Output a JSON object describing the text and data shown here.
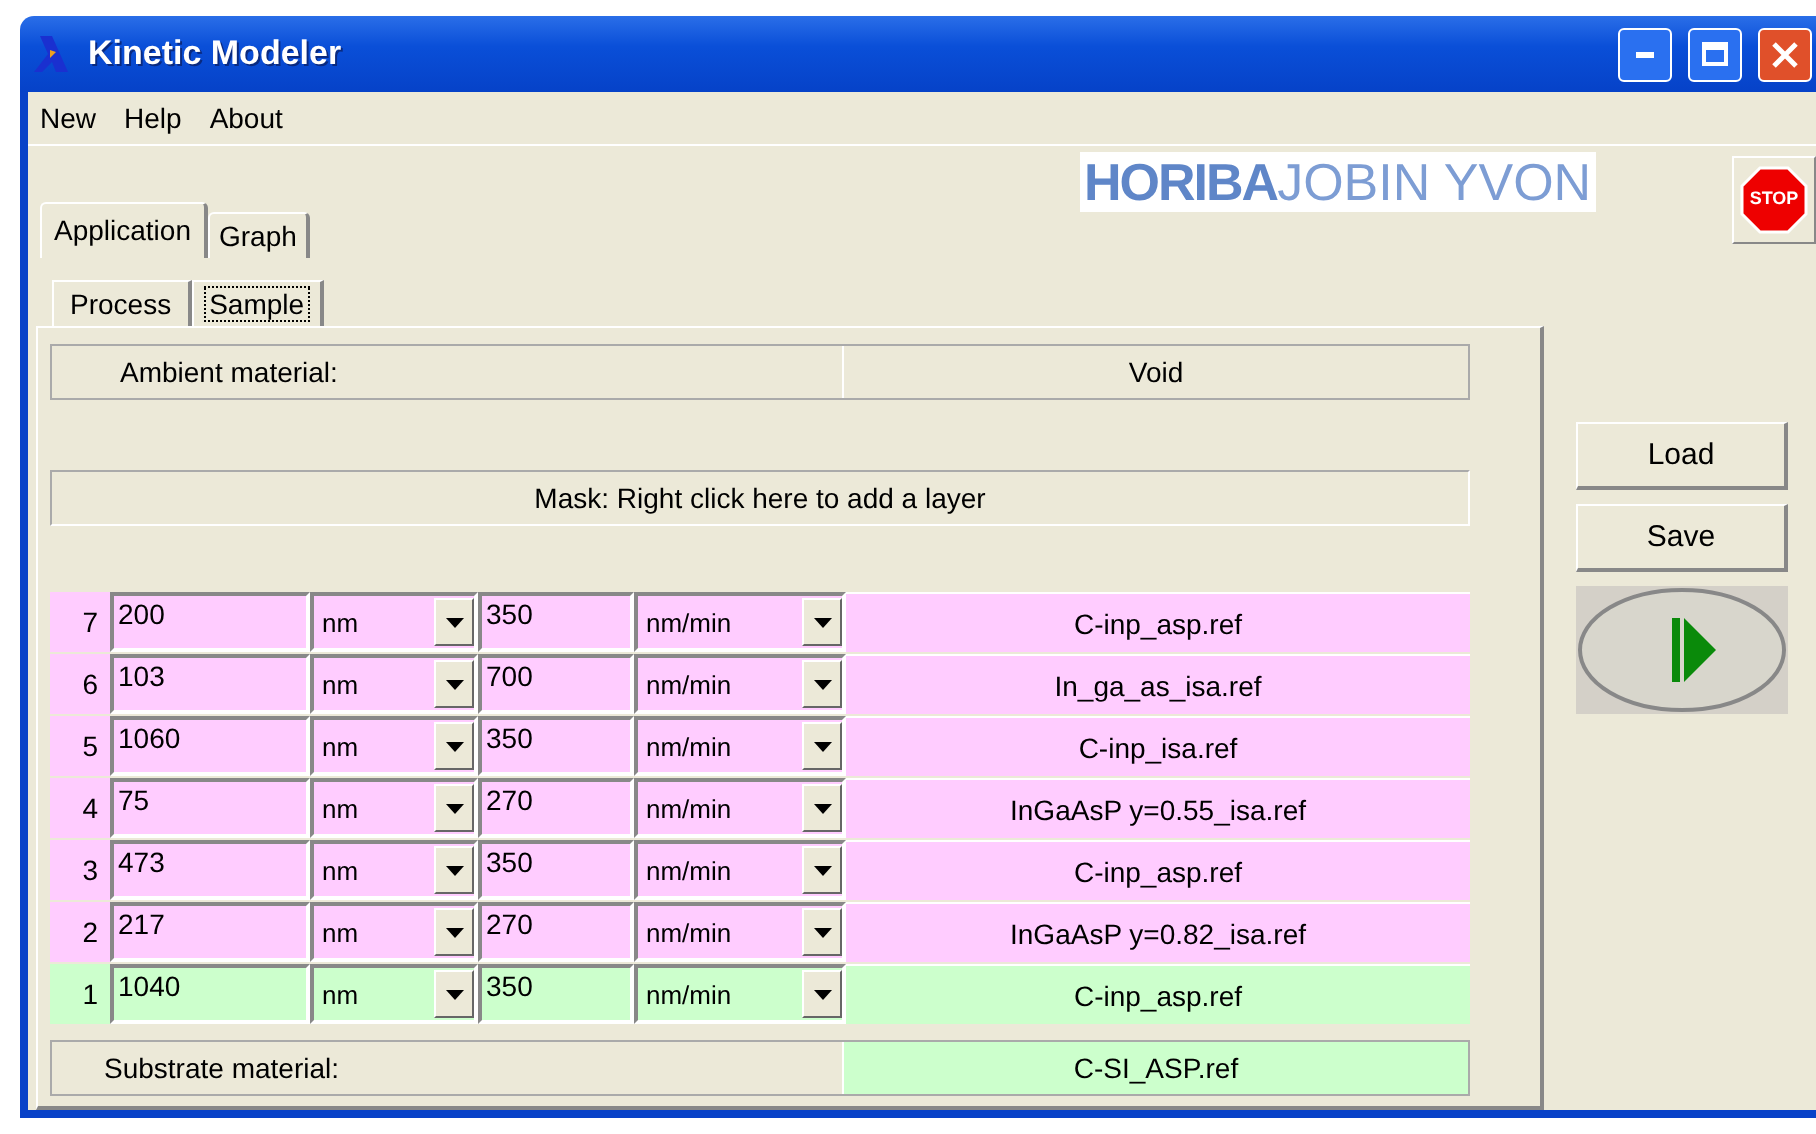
{
  "window": {
    "title": "Kinetic Modeler"
  },
  "menu": [
    {
      "label": "New"
    },
    {
      "label": "Help"
    },
    {
      "label": "About"
    }
  ],
  "logo": {
    "bold": "HORIBA",
    "light": "JOBIN YVON"
  },
  "stop_button": {
    "label": "STOP"
  },
  "tabs": [
    {
      "label": "Application",
      "selected": true
    },
    {
      "label": "Graph",
      "selected": false
    }
  ],
  "subtabs": [
    {
      "label": "Process",
      "selected": false
    },
    {
      "label": "Sample",
      "selected": true
    }
  ],
  "ambient": {
    "label": "Ambient material:",
    "value": "Void"
  },
  "mask": {
    "label": "Mask: Right click here to add a layer"
  },
  "layers": [
    {
      "index": "7",
      "thickness": "200",
      "thickness_unit": "nm",
      "rate": "350",
      "rate_unit": "nm/min",
      "material": "C-inp_asp.ref",
      "color": "#ffccff"
    },
    {
      "index": "6",
      "thickness": "103",
      "thickness_unit": "nm",
      "rate": "700",
      "rate_unit": "nm/min",
      "material": "In_ga_as_isa.ref",
      "color": "#ffccff"
    },
    {
      "index": "5",
      "thickness": "1060",
      "thickness_unit": "nm",
      "rate": "350",
      "rate_unit": "nm/min",
      "material": "C-inp_isa.ref",
      "color": "#ffccff"
    },
    {
      "index": "4",
      "thickness": "75",
      "thickness_unit": "nm",
      "rate": "270",
      "rate_unit": "nm/min",
      "material": "InGaAsP y=0.55_isa.ref",
      "color": "#ffccff"
    },
    {
      "index": "3",
      "thickness": "473",
      "thickness_unit": "nm",
      "rate": "350",
      "rate_unit": "nm/min",
      "material": "C-inp_asp.ref",
      "color": "#ffccff"
    },
    {
      "index": "2",
      "thickness": "217",
      "thickness_unit": "nm",
      "rate": "270",
      "rate_unit": "nm/min",
      "material": "InGaAsP y=0.82_isa.ref",
      "color": "#ffccff"
    },
    {
      "index": "1",
      "thickness": "1040",
      "thickness_unit": "nm",
      "rate": "350",
      "rate_unit": "nm/min",
      "material": "C-inp_asp.ref",
      "color": "#ccffcc"
    }
  ],
  "substrate": {
    "label": "Substrate material:",
    "value": "C-SI_ASP.ref",
    "color": "#ccffcc"
  },
  "buttons": [
    {
      "label": "Load"
    },
    {
      "label": "Save"
    }
  ]
}
